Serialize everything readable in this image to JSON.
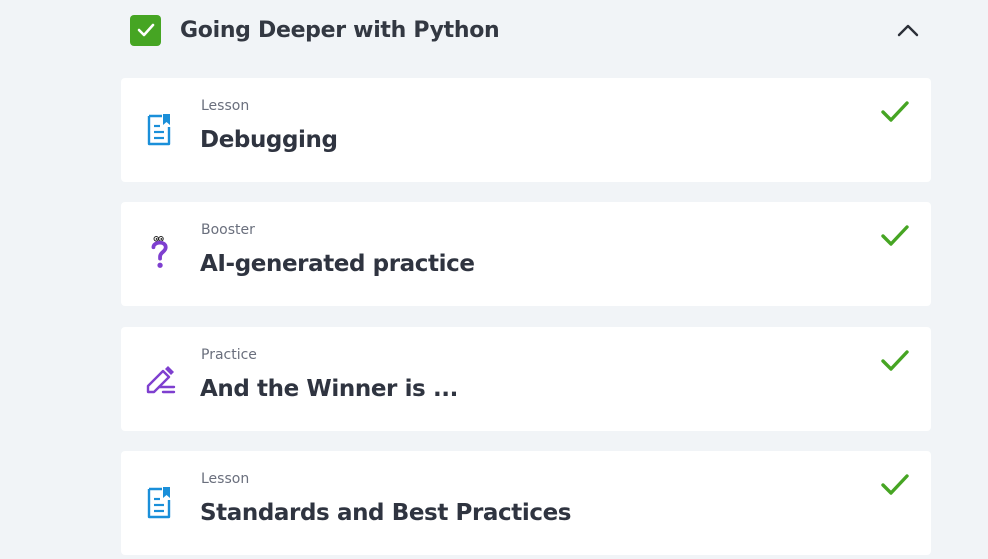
{
  "section": {
    "title": "Going Deeper with Python",
    "completed": true,
    "expanded": true
  },
  "items": [
    {
      "type": "Lesson",
      "title": "Debugging",
      "icon": "lesson-document-icon",
      "completed": true
    },
    {
      "type": "Booster",
      "title": "AI-generated practice",
      "icon": "question-mark-character-icon",
      "completed": true
    },
    {
      "type": "Practice",
      "title": "And the Winner is ...",
      "icon": "pencil-edit-icon",
      "completed": true
    },
    {
      "type": "Lesson",
      "title": "Standards and Best Practices",
      "icon": "lesson-document-icon",
      "completed": true
    }
  ],
  "colors": {
    "background": "#f1f4f7",
    "card": "#ffffff",
    "success_green": "#46a523",
    "lesson_blue": "#1a8fd9",
    "purple": "#7e3fcf"
  }
}
